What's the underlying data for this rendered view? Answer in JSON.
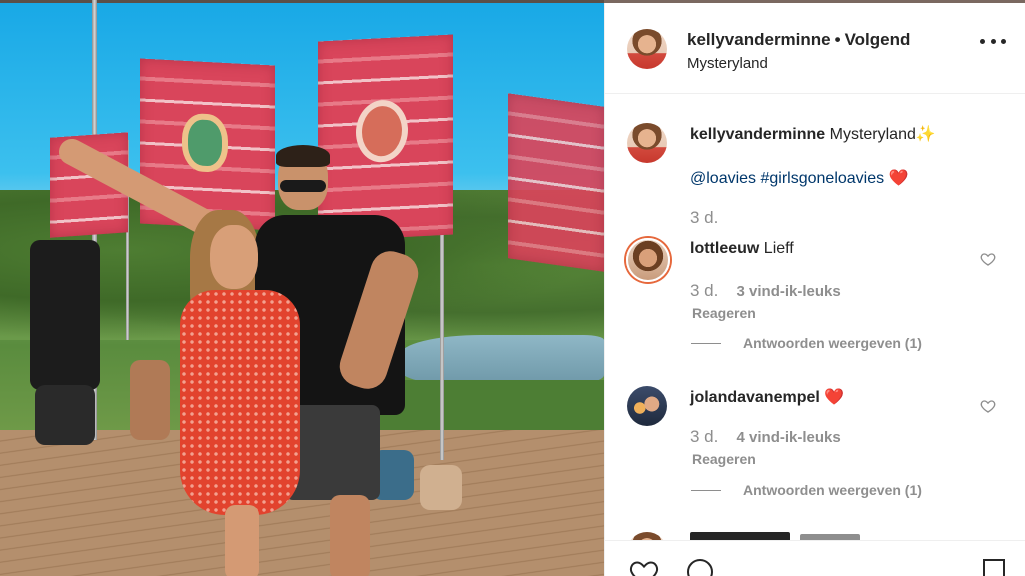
{
  "post": {
    "username": "kellyvanderminne",
    "separator": "•",
    "follow_label": "Volgend",
    "location": "Mysteryland",
    "more_icon": "more-options-icon"
  },
  "caption": {
    "username": "kellyvanderminne",
    "text": "Mysteryland",
    "sparkle": "✨",
    "mention": "@loavies",
    "hashtag": "#girlsgoneloavies",
    "heart": "❤️",
    "age": "3 d."
  },
  "comments": [
    {
      "username": "lottleeuw",
      "text": "Lieff",
      "emoji": "",
      "age": "3 d.",
      "likes": "3 vind-ik-leuks",
      "reply_label": "Reageren",
      "view_replies": "Antwoorden weergeven (1)"
    },
    {
      "username": "jolandavanempel",
      "text": "",
      "emoji": "❤️",
      "age": "3 d.",
      "likes": "4 vind-ik-leuks",
      "reply_label": "Reageren",
      "view_replies": "Antwoorden weergeven (1)"
    }
  ],
  "actions": {
    "like_icon": "heart-icon",
    "comment_icon": "comment-icon",
    "save_icon": "bookmark-icon"
  },
  "colors": {
    "link": "#00376b",
    "muted": "#8e8e8e",
    "text": "#262626",
    "heart": "#ed1c24"
  }
}
